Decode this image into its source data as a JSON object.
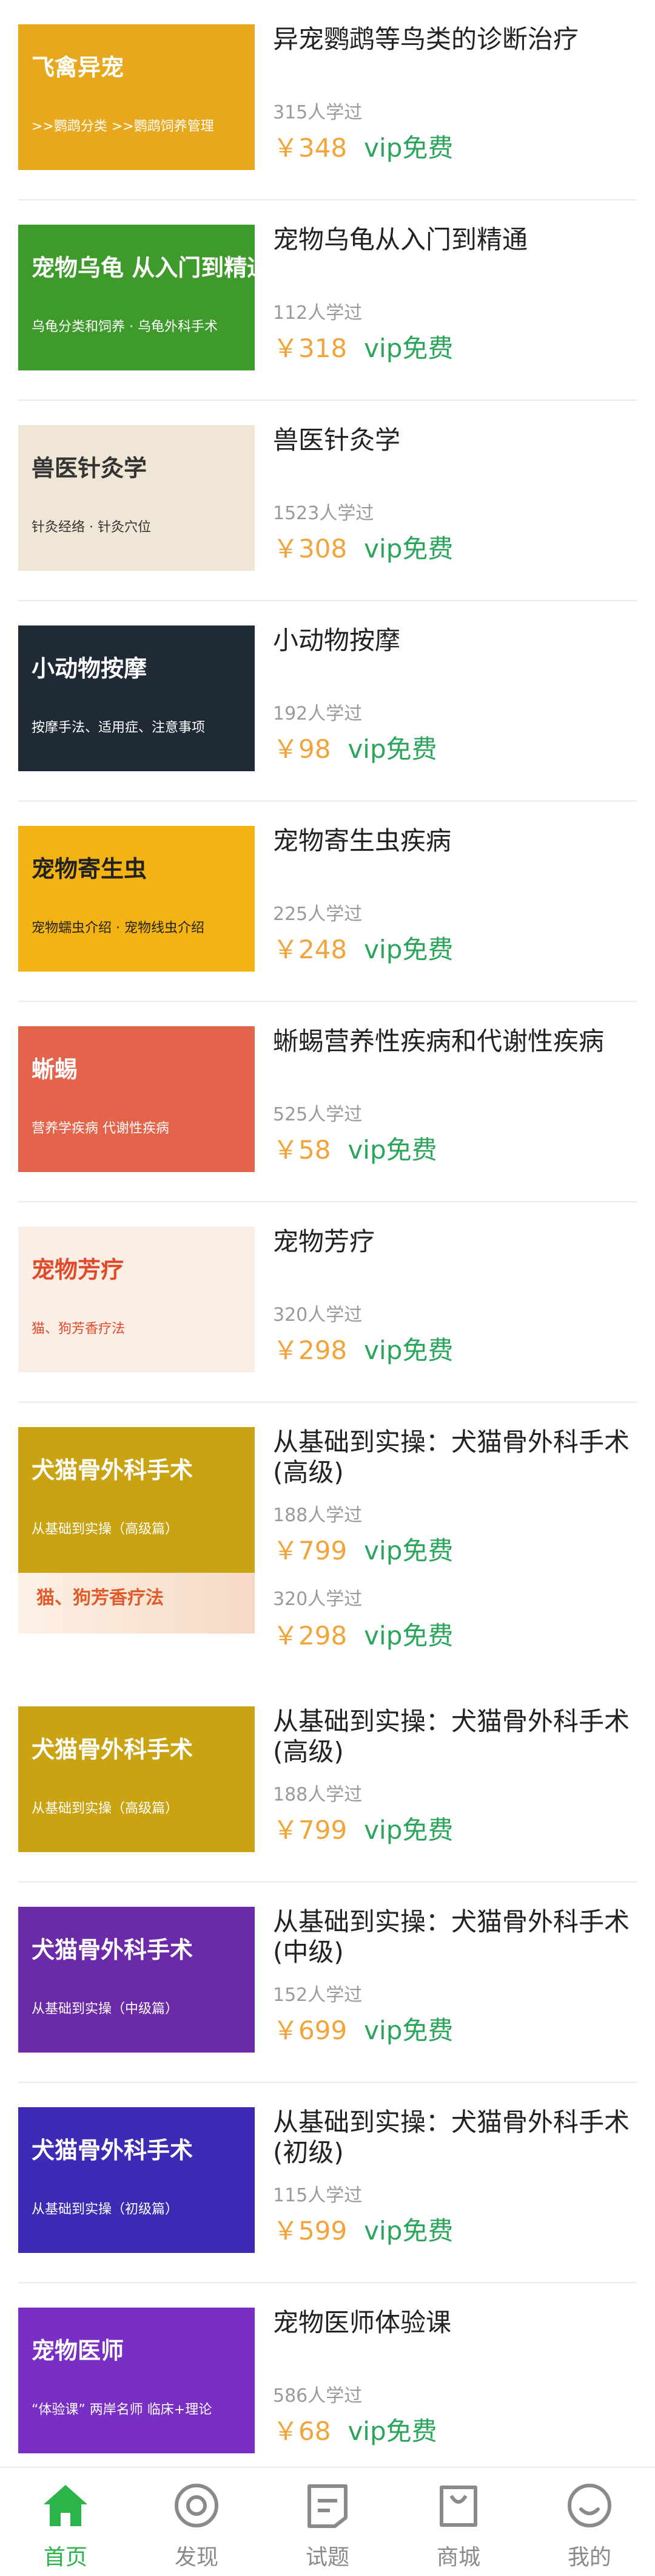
{
  "courses": [
    {
      "title": "异宠鹦鹉等鸟类的诊断治疗",
      "learners": "315人学过",
      "price": "￥348",
      "vip": "vip免费",
      "thumb": {
        "line1": "飞禽异宠",
        "line2": ">>鹦鹉分类  >>鹦鹉饲养管理",
        "bg": "#e7a81e",
        "fg": "#ffffff"
      }
    },
    {
      "title": "宠物乌龟从入门到精通",
      "learners": "112人学过",
      "price": "￥318",
      "vip": "vip免费",
      "thumb": {
        "line1": "宠物乌龟 从入门到精通",
        "line2": "乌龟分类和饲养 · 乌龟外科手术",
        "bg": "#3f9a2c",
        "fg": "#ffffff"
      }
    },
    {
      "title": "兽医针灸学",
      "learners": "1523人学过",
      "price": "￥308",
      "vip": "vip免费",
      "thumb": {
        "line1": "兽医针灸学",
        "line2": "针灸经络 · 针灸穴位",
        "bg": "#efe6d6",
        "fg": "#333333"
      }
    },
    {
      "title": "小动物按摩",
      "learners": "192人学过",
      "price": "￥98",
      "vip": "vip免费",
      "thumb": {
        "line1": "小动物按摩",
        "line2": "按摩手法、适用症、注意事项",
        "bg": "#1f2a36",
        "fg": "#ffffff"
      }
    },
    {
      "title": "宠物寄生虫疾病",
      "learners": "225人学过",
      "price": "￥248",
      "vip": "vip免费",
      "thumb": {
        "line1": "宠物寄生虫",
        "line2": "宠物蠕虫介绍 · 宠物线虫介绍",
        "bg": "#f3b413",
        "fg": "#222222"
      }
    },
    {
      "title": "蜥蜴营养性疾病和代谢性疾病",
      "learners": "525人学过",
      "price": "￥58",
      "vip": "vip免费",
      "thumb": {
        "line1": "蜥蜴",
        "line2": "营养学疾病 代谢性疾病",
        "bg": "#e4634b",
        "fg": "#ffffff"
      }
    },
    {
      "title": "宠物芳疗",
      "learners": "320人学过",
      "price": "￥298",
      "vip": "vip免费",
      "thumb": {
        "line1": "宠物芳疗",
        "line2": "猫、狗芳香疗法",
        "bg": "#fbeee5",
        "fg": "#e04a2a"
      }
    },
    {
      "title": "从基础到实操：犬猫骨外科手术(高级)",
      "learners": "188人学过",
      "price": "￥799",
      "vip": "vip免费",
      "thumb": {
        "line1": "犬猫骨外科手术",
        "line2": "从基础到实操（高级篇）",
        "bg": "#c9a312",
        "fg": "#ffffff"
      }
    },
    {
      "title": "从基础到实操：犬猫骨外科手术(高级)",
      "learners": "188人学过",
      "price": "￥799",
      "vip": "vip免费",
      "thumb": {
        "line1": "犬猫骨外科手术",
        "line2": "从基础到实操（高级篇）",
        "bg": "#c9a312",
        "fg": "#ffffff"
      }
    },
    {
      "title": "从基础到实操：犬猫骨外科手术(中级)",
      "learners": "152人学过",
      "price": "￥699",
      "vip": "vip免费",
      "thumb": {
        "line1": "犬猫骨外科手术",
        "line2": "从基础到实操（中级篇）",
        "bg": "#6b2aa8",
        "fg": "#ffffff"
      }
    },
    {
      "title": "从基础到实操：犬猫骨外科手术(初级)",
      "learners": "115人学过",
      "price": "￥599",
      "vip": "vip免费",
      "thumb": {
        "line1": "犬猫骨外科手术",
        "line2": "从基础到实操（初级篇）",
        "bg": "#3d2bb5",
        "fg": "#ffffff"
      }
    },
    {
      "title": "宠物医师体验课",
      "learners": "586人学过",
      "price": "￥68",
      "vip": "vip免费",
      "thumb": {
        "line1": "宠物医师",
        "line2": "“体验课”  两岸名师 临床+理论",
        "bg": "#7a2fc4",
        "fg": "#ffffff"
      }
    }
  ],
  "overlay": {
    "line2": "猫、狗芳香疗法",
    "learners": "320人学过",
    "price": "￥298",
    "vip": "vip免费"
  },
  "tabs": [
    {
      "label": "首页",
      "icon": "home-icon",
      "active": true
    },
    {
      "label": "发现",
      "icon": "discover-icon",
      "active": false
    },
    {
      "label": "试题",
      "icon": "quiz-icon",
      "active": false
    },
    {
      "label": "商城",
      "icon": "shop-bag-icon",
      "active": false
    },
    {
      "label": "我的",
      "icon": "profile-icon",
      "active": false
    }
  ],
  "colors": {
    "accent": "#2bb44a",
    "price": "#f2a33a",
    "vip": "#2aa55b"
  }
}
